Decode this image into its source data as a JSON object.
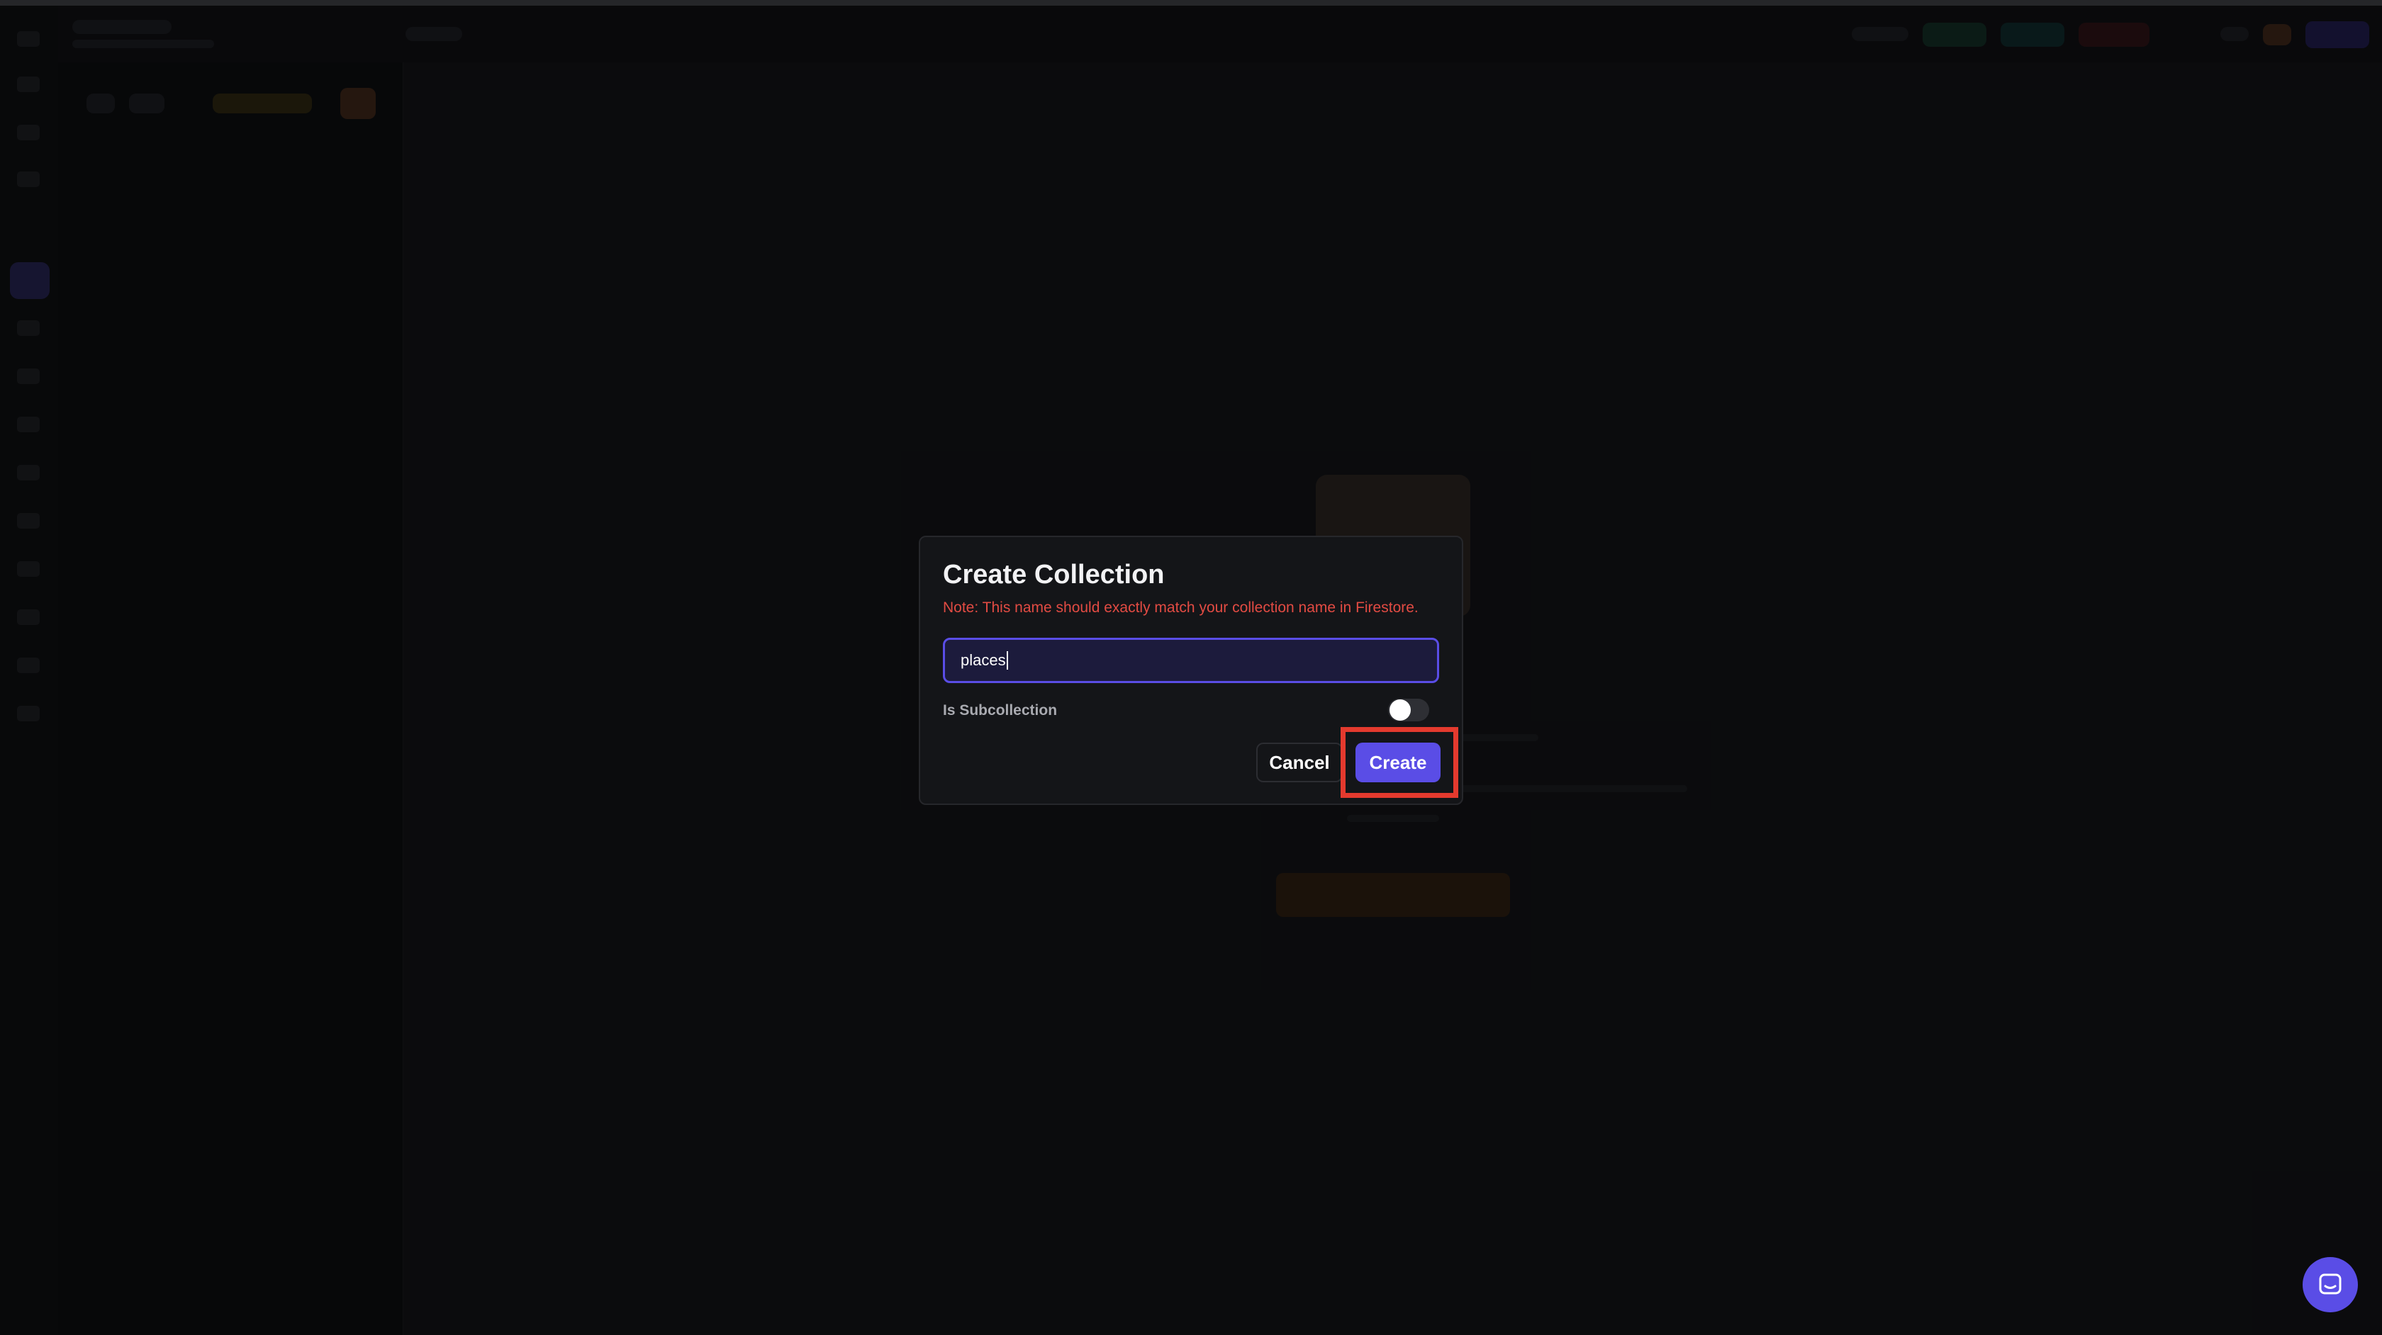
{
  "dialog": {
    "title": "Create Collection",
    "note": "Note: This name should exactly match your collection name in Firestore.",
    "name_input_value": "places",
    "subcollection_label": "Is Subcollection",
    "subcollection_enabled": false,
    "cancel_label": "Cancel",
    "create_label": "Create"
  },
  "colors": {
    "accent": "#5a4de6",
    "note_red": "#e24b43",
    "highlight_red": "#e43a2e",
    "dialog_bg": "#141518"
  },
  "icons": {
    "chat_launcher": "chat-bubble-icon"
  }
}
